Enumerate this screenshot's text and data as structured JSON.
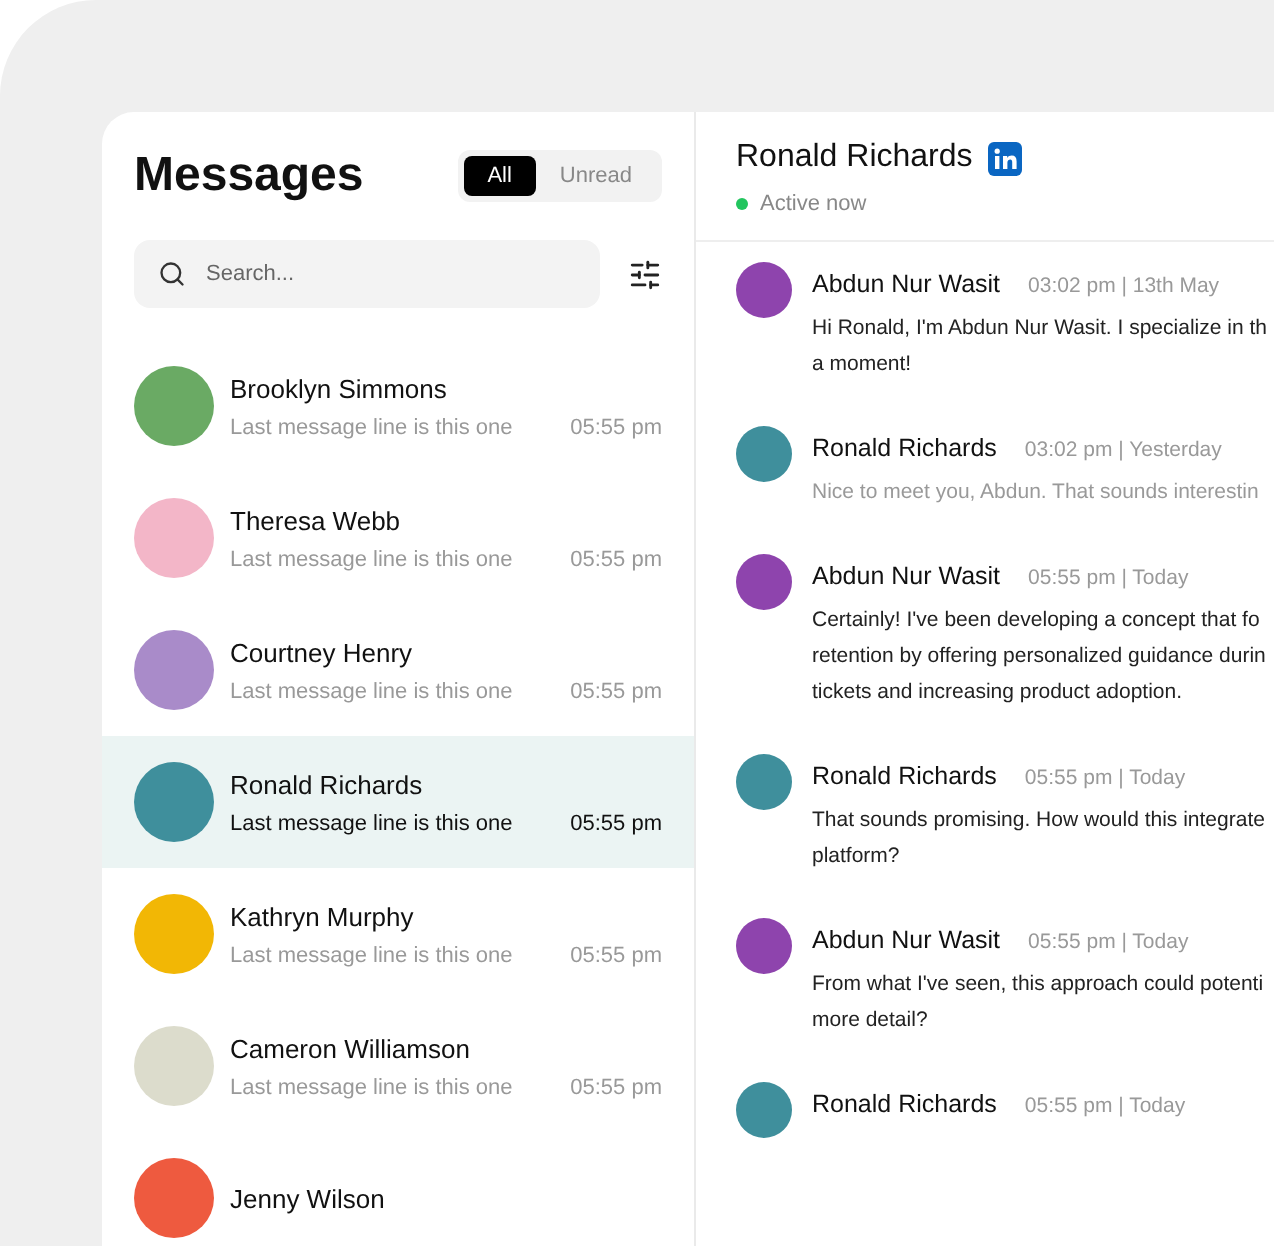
{
  "sidebar": {
    "title": "Messages",
    "filters": [
      {
        "label": "All",
        "selected": true
      },
      {
        "label": "Unread",
        "selected": false
      }
    ],
    "search": {
      "placeholder": "Search..."
    },
    "conversations": [
      {
        "name": "Brooklyn Simmons",
        "preview": "Last message line is this one",
        "time": "05:55 pm",
        "selected": false,
        "color": "#6aaa64"
      },
      {
        "name": "Theresa Webb",
        "preview": "Last message line is this one",
        "time": "05:55 pm",
        "selected": false,
        "color": "#f3b6c8"
      },
      {
        "name": "Courtney Henry",
        "preview": "Last message line is this one",
        "time": "05:55 pm",
        "selected": false,
        "color": "#a98bc9"
      },
      {
        "name": "Ronald Richards",
        "preview": "Last message line is this one",
        "time": "05:55 pm",
        "selected": true,
        "color": "#3f8f9c"
      },
      {
        "name": "Kathryn Murphy",
        "preview": "Last message line is this one",
        "time": "05:55 pm",
        "selected": false,
        "color": "#f2b705"
      },
      {
        "name": "Cameron Williamson",
        "preview": "Last message line is this one",
        "time": "05:55 pm",
        "selected": false,
        "color": "#dcdccc"
      },
      {
        "name": "Jenny Wilson",
        "selected": false,
        "color": "#ee5a3f"
      }
    ]
  },
  "chat": {
    "name": "Ronald Richards",
    "status": "Active now",
    "online": true,
    "messages": [
      {
        "author": "Abdun Nur Wasit",
        "meta": "03:02 pm | 13th May",
        "color": "#8e44ad",
        "muted": false,
        "lines": [
          "Hi Ronald, I'm Abdun Nur Wasit. I specialize in th",
          "a moment!"
        ]
      },
      {
        "author": "Ronald Richards",
        "meta": "03:02 pm | Yesterday",
        "color": "#3f8f9c",
        "muted": true,
        "lines": [
          "Nice to meet you, Abdun. That sounds interestin"
        ]
      },
      {
        "author": "Abdun Nur Wasit",
        "meta": "05:55 pm | Today",
        "color": "#8e44ad",
        "muted": false,
        "lines": [
          "Certainly! I've been developing a concept that fo",
          "retention by offering personalized guidance durin",
          "tickets and increasing product adoption."
        ]
      },
      {
        "author": "Ronald Richards",
        "meta": "05:55 pm | Today",
        "color": "#3f8f9c",
        "muted": false,
        "lines": [
          "That sounds promising. How would this integrate",
          "platform?"
        ]
      },
      {
        "author": "Abdun Nur Wasit",
        "meta": "05:55 pm | Today",
        "color": "#8e44ad",
        "muted": false,
        "lines": [
          "From what I've seen, this approach could potenti",
          "more detail?"
        ]
      },
      {
        "author": "Ronald Richards",
        "meta": "05:55 pm | Today",
        "color": "#3f8f9c"
      }
    ]
  }
}
